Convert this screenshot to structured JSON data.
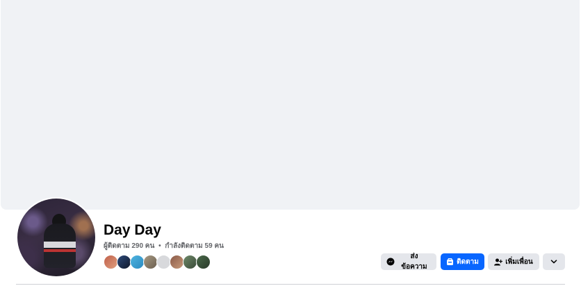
{
  "profile": {
    "name": "Day Day",
    "followers": "ผู้ติดตาม 290 คน",
    "separator": "•",
    "following": "กำลังติดตาม 59 คน"
  },
  "friends": {
    "avatars": [
      {
        "color": "#c0604a"
      },
      {
        "color": "#2d4a7a"
      },
      {
        "color": "#4fb4e0"
      },
      {
        "color": "#a89a84"
      },
      {
        "color": "#d8d9dc"
      },
      {
        "color": "#8a5a48"
      },
      {
        "color": "#6f8a6a"
      },
      {
        "color": "#4a6a4a"
      }
    ]
  },
  "actions": {
    "message_label": "ส่งข้อความ",
    "follow_label": "ติดตาม",
    "add_friend_label": "เพิ่มเพื่อน",
    "more_icon": "chevron-down-icon"
  },
  "colors": {
    "primary": "#0866ff",
    "secondary_button": "#e4e6eb",
    "cover": "#f0f2f5"
  }
}
